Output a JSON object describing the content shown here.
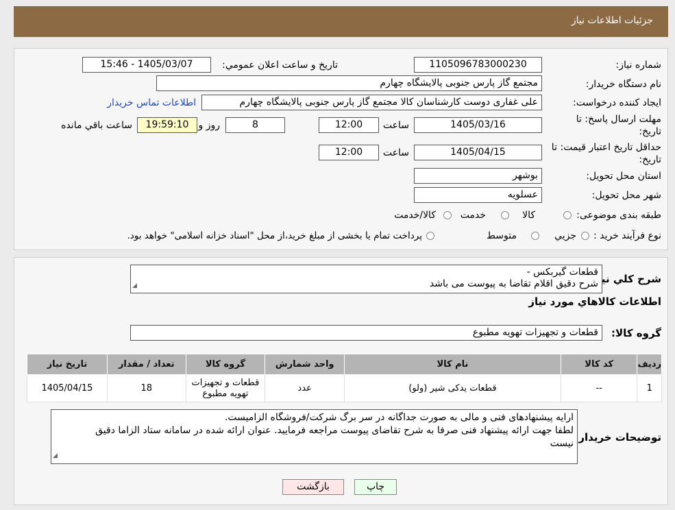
{
  "header": {
    "title": "جزئیات اطلاعات نیاز"
  },
  "form": {
    "need_number_label": "شماره نیاز:",
    "need_number": "1105096783000230",
    "announce_label": "تاریخ و ساعت اعلان عمومي:",
    "announce_value": "1405/03/07 - 15:46",
    "buyer_label": "نام دستگاه خریدار:",
    "buyer_value": "مجتمع گاز پارس جنوبی  پالایشگاه چهارم",
    "creator_label": "ایجاد کننده درخواست:",
    "creator_value": "علی غفاری دوست کارشناسان کالا مجتمع گاز پارس جنوبی  پالایشگاه چهارم",
    "contact_link": "اطلاعات تماس خریدار",
    "deadline_label_1": "مهلت ارسال پاسخ: تا",
    "deadline_label_2": "تاریخ:",
    "deadline_date": "1405/03/16",
    "time_label": "ساعت",
    "deadline_time": "12:00",
    "days_value": "8",
    "days_label": "روز و",
    "remaining_time": "19:59:10",
    "remaining_label": "ساعت باقي مانده",
    "validity_label_1": "حداقل تاریخ اعتبار قیمت: تا",
    "validity_label_2": "تاریخ:",
    "validity_date": "1405/04/15",
    "validity_time": "12:00",
    "province_label": "استان محل تحویل:",
    "province_value": "بوشهر",
    "city_label": "شهر محل تحویل:",
    "city_value": "عسلویه",
    "category_label": "طبقه بندی موضوعی:",
    "category_options": [
      "کالا",
      "خدمت",
      "کالا/خدمت"
    ],
    "process_label": "نوع فرآیند خرید :",
    "process_options": [
      "جزیي",
      "متوسط"
    ],
    "process_note": "پرداخت تمام یا بخشی از مبلغ خرید،از محل \"اسناد خزانه اسلامی\" خواهد بود."
  },
  "details": {
    "summary_label": "شرح کلي نياز:",
    "summary_line1": "قطعات گیربکس -",
    "summary_line2": "شرح دقیق اقلام تقاضا به پیوست می باشد",
    "items_heading": "اطلاعات کالاهاي مورد نياز",
    "group_label": "گروه کالا:",
    "group_value": "قطعات و تجهیزات تهویه مطبوع",
    "table_headers": [
      "ردیف",
      "کد کالا",
      "نام کالا",
      "واحد شمارش",
      "گروه کالا",
      "تعداد / مقدار",
      "تاریخ نیاز"
    ],
    "rows": [
      {
        "index": "1",
        "code": "--",
        "name": "قطعات یدکی شیر (ولو)",
        "unit": "عدد",
        "group": "قطعات و تجهیزات تهویه مطبوع",
        "qty": "18",
        "date": "1405/04/15"
      }
    ],
    "notes_label": "توضیحات خریدار:",
    "notes_line1": "ارایه پیشنهادهای فنی و مالی به صورت جداگانه در سر برگ شرکت/فروشگاه الزامیست.",
    "notes_line2": "لطفا جهت ارائه پیشنهاد فنی صرفا به شرح تقاضای پیوست مراجعه فرمایید. عنوان ارائه شده در سامانه ستاد الزاما دقیق",
    "notes_line3": "نیست"
  },
  "buttons": {
    "print": "چاپ",
    "back": "بازگشت"
  },
  "colors": {
    "header": "#8b6a44",
    "link": "#1a48c8",
    "print_bg": "#eaffea",
    "back_bg": "#ffe6e6"
  }
}
